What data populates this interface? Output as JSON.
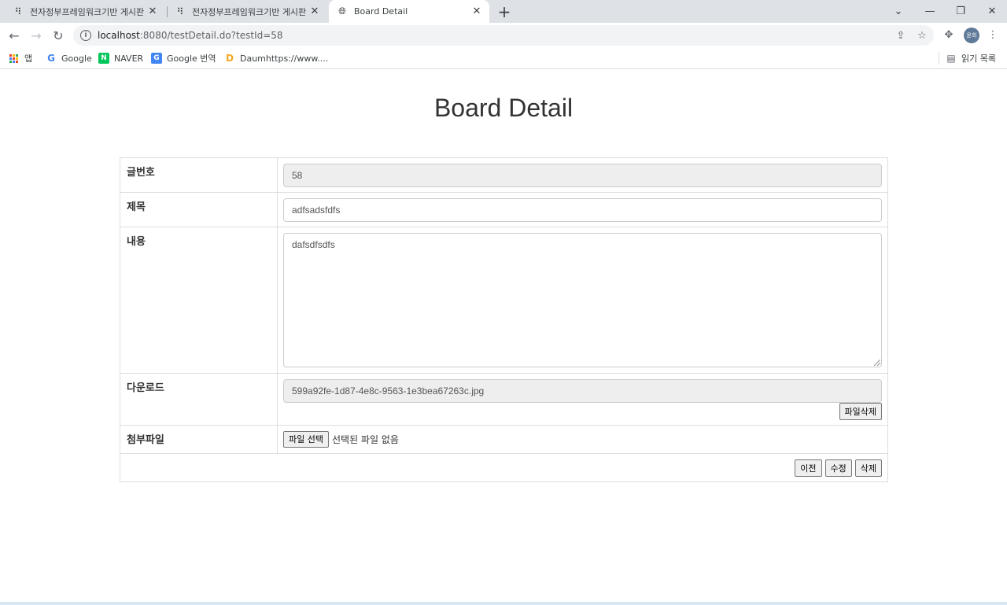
{
  "browser": {
    "tabs": [
      {
        "title": "전자정부프레임워크기반 게시판",
        "active": false
      },
      {
        "title": "전자정부프레임워크기반 게시판",
        "active": false
      },
      {
        "title": "Board Detail",
        "active": true
      }
    ],
    "url_host": "localhost",
    "url_rest": ":8080/testDetail.do?testId=58",
    "profile_label": "윤희",
    "bookmarks": [
      {
        "label": "앱",
        "icon": "apps-grid-icon"
      },
      {
        "label": "Google",
        "icon": "google-icon"
      },
      {
        "label": "NAVER",
        "icon": "naver-icon"
      },
      {
        "label": "Google 번역",
        "icon": "google-translate-icon"
      },
      {
        "label": "Daumhttps://www....",
        "icon": "daum-icon"
      }
    ],
    "reading_list_label": "읽기 목록"
  },
  "page": {
    "title": "Board Detail",
    "fields": {
      "id_label": "글번호",
      "id_value": "58",
      "title_label": "제목",
      "title_value": "adfsadsfdfs",
      "content_label": "내용",
      "content_value": "dafsdfsdfs",
      "download_label": "다운로드",
      "download_value": "599a92fe-1d87-4e8c-9563-1e3bea67263c.jpg",
      "delete_file_label": "파일삭제",
      "attach_label": "첨부파일",
      "choose_file_label": "파일 선택",
      "no_file_text": "선택된 파일 없음"
    },
    "actions": {
      "prev_label": "이전",
      "edit_label": "수정",
      "delete_label": "삭제"
    }
  },
  "colors": {
    "tabstrip_bg": "#dee1e6",
    "naver_green": "#03c75a",
    "daum_orange": "#f5a623"
  }
}
